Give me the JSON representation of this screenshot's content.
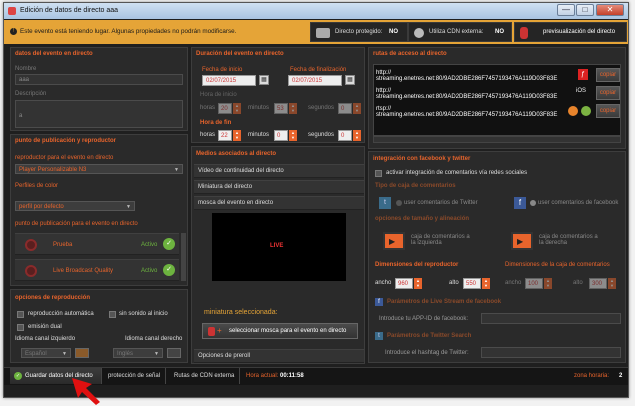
{
  "window": {
    "title": "Edición de datos de directo aaa",
    "min": "—",
    "max": "□",
    "close": "✕"
  },
  "warning": "Este evento está teniendo lugar. Algunas propiedades no podrán modificarse.",
  "status": {
    "protected_label": "Directo protegido:",
    "protected_value": "NO",
    "cdn_label": "Utiliza CDN externa:",
    "cdn_value": "NO",
    "preview": "previsualización del directo"
  },
  "event": {
    "section": "datos del evento en directo",
    "name_label": "Nombre",
    "name_value": "aaa",
    "desc_label": "Descripción",
    "desc_value": "a"
  },
  "publish": {
    "section": "punto de publicación y reproductor",
    "player_label": "reproductor para el evento en directo",
    "player_value": "Player Personalizable N3",
    "color_label": "Perfiles de color",
    "color_value": "perfil por defecto",
    "points_label": "punto de publicación para el evento en directo",
    "points": [
      {
        "name": "Prueba",
        "state": "Activo"
      },
      {
        "name": "Live Broadcast Quality",
        "state": "Activo"
      }
    ]
  },
  "playback": {
    "section": "opciones de reproducción",
    "auto": "reproducción automática",
    "mute": "sin sonido al inicio",
    "dual": "emisión dual",
    "left_label": "Idioma canal izquierdo",
    "right_label": "Idioma canal derecho",
    "left_value": "Español",
    "right_value": "Inglés"
  },
  "duration": {
    "section": "Duración del evento en directo",
    "start_label": "Fecha de inicio",
    "start_value": "02/07/2015",
    "end_label": "Fecha de finalización",
    "end_value": "02/07/2015",
    "hstart_label": "Hora de inicio",
    "hend_label": "Hora de fin",
    "horas": "horas",
    "minutos": "minutos",
    "segundos": "segundos",
    "start_h": "20",
    "start_m": "53",
    "start_s": "0",
    "end_h": "22",
    "end_m": "0",
    "end_s": "0"
  },
  "media": {
    "section": "Medios asociados al directo",
    "items": [
      "Vídeo de continuidad del directo",
      "Miniatura del directo",
      "mosca del evento en directo"
    ],
    "preview_text": "LIVE",
    "selected_label": "miniatura seleccionada:",
    "select_button": "seleccionar mosca para el evento en directo",
    "preroll": "Opciones de preroll"
  },
  "routes": {
    "section": "rutas de acceso al directo",
    "copy": "copiar",
    "items": [
      {
        "proto": "http://",
        "url": "streaming.enetres.net:80/9AD2DBE286F7457193476A119D03F83E"
      },
      {
        "proto": "http://",
        "url": "streaming.enetres.net:80/9AD2DBE286F7457193476A119D03F83E"
      },
      {
        "proto": "rtsp://",
        "url": "streaming.enetres.net:80/9AD2DBE286F7457193476A119D03F83E"
      }
    ]
  },
  "social": {
    "section": "integración con facebook y twitter",
    "activate": "activar integración de comentarios vía redes sociales",
    "type_label": "Tipo de caja de comentarios",
    "twitter": "user comentarios de Twitter",
    "facebook": "user comentarios de facebook",
    "size_label": "opciones de tamaño y alineación",
    "left": "caja de comentarios a la izquierda",
    "right": "caja de comentarios a la derecha",
    "player_dims": "Dimensiones del reproductor",
    "box_dims": "Dimensiones de la caja de comentarios",
    "ancho": "ancho",
    "alto": "alto",
    "p_w": "960",
    "p_h": "550",
    "b_w": "100",
    "b_h": "300",
    "fb_section": "Parámetros de Live Stream de facebook",
    "fb_field": "Introduce tu APP-ID de facebook:",
    "tw_section": "Parámetros de Twitter Search",
    "tw_field": "Introduce el hashtag de Twitter:"
  },
  "bottom": {
    "save": "Guardar datos del directo",
    "tab2": "protección de señal",
    "tab3": "Rutas de CDN externa",
    "time_label": "Hora actual:",
    "time_value": "00:11:58",
    "zone_label": "zona horaria:",
    "zone_value": "2"
  },
  "colors": {
    "accent": "#e8642c",
    "warning": "#e5a437",
    "background": "#1f1f1f",
    "active": "#6db33f"
  }
}
